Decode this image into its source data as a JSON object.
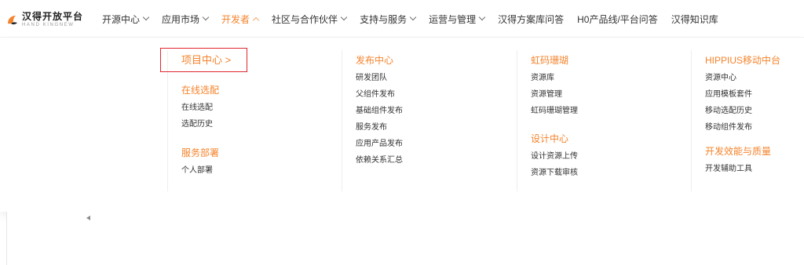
{
  "logo": {
    "name": "汉得开放平台",
    "subtitle": "HAND KINGNEW"
  },
  "nav": [
    {
      "label": "开源中心",
      "has_dropdown": true,
      "active": false
    },
    {
      "label": "应用市场",
      "has_dropdown": true,
      "active": false
    },
    {
      "label": "开发者",
      "has_dropdown": true,
      "active": true
    },
    {
      "label": "社区与合作伙伴",
      "has_dropdown": true,
      "active": false
    },
    {
      "label": "支持与服务",
      "has_dropdown": true,
      "active": false
    },
    {
      "label": "运营与管理",
      "has_dropdown": true,
      "active": false
    },
    {
      "label": "汉得方案库问答",
      "has_dropdown": false,
      "active": false
    },
    {
      "label": "H0产品线/平台问答",
      "has_dropdown": false,
      "active": false
    },
    {
      "label": "汉得知识库",
      "has_dropdown": false,
      "active": false
    }
  ],
  "menu": {
    "col1": {
      "project_center": "项目中心 >",
      "online_config": {
        "title": "在线选配",
        "links": [
          "在线选配",
          "选配历史"
        ]
      },
      "service_deploy": {
        "title": "服务部署",
        "links": [
          "个人部署"
        ]
      }
    },
    "col2": {
      "release_center": {
        "title": "发布中心",
        "links": [
          "研发团队",
          "父组件发布",
          "基础组件发布",
          "服务发布",
          "应用产品发布",
          "依赖关系汇总"
        ]
      }
    },
    "col3": {
      "coral": {
        "title": "虹码珊瑚",
        "links": [
          "资源库",
          "资源管理",
          "虹码珊瑚管理"
        ]
      },
      "design_center": {
        "title": "设计中心",
        "links": [
          "设计资源上传",
          "资源下载审核"
        ]
      }
    },
    "col4": {
      "hippius": {
        "title": "HIPPIUS移动中台",
        "links": [
          "资源中心",
          "应用模板套件",
          "移动选配历史",
          "移动组件发布"
        ]
      },
      "efficiency": {
        "title": "开发效能与质量",
        "links": [
          "开发辅助工具"
        ]
      }
    }
  },
  "colors": {
    "accent": "#f5832b",
    "highlight": "#e0262f"
  }
}
